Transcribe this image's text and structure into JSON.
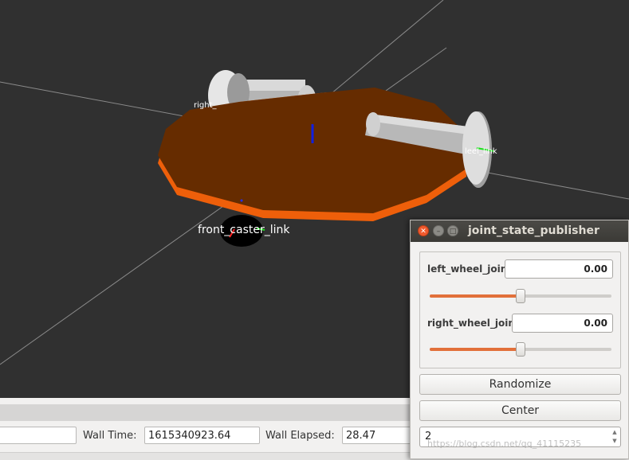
{
  "scene": {
    "frames": {
      "right_label": "right_",
      "left_label": "leel_link",
      "caster_label": "front_caster_link"
    },
    "colors": {
      "background": "#303030",
      "base_top": "#662c00",
      "base_rim": "#ee5f0a",
      "wheel": "#c8c8c8"
    }
  },
  "status_bar": {
    "wall_time_label": "Wall Time:",
    "wall_time_value": "1615340923.64",
    "wall_elapsed_label": "Wall Elapsed:",
    "wall_elapsed_value": "28.47",
    "left_field_value": ""
  },
  "joint_state_publisher": {
    "title": "joint_state_publisher",
    "close_glyph": "✕",
    "min_glyph": "–",
    "max_glyph": "□",
    "joints": [
      {
        "name": "left_wheel_joint",
        "value": "0.00",
        "slider_fraction": 0.5
      },
      {
        "name": "right_wheel_joint",
        "value": "0.00",
        "slider_fraction": 0.5
      }
    ],
    "randomize_label": "Randomize",
    "center_label": "Center",
    "spin_value": "2",
    "spin_up": "▲",
    "spin_down": "▼"
  },
  "watermark": "https://blog.csdn.net/qq_41115235"
}
